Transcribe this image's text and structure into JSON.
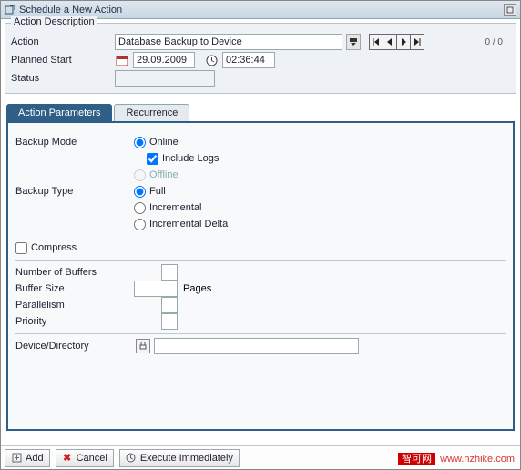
{
  "title": "Schedule a New Action",
  "desc": {
    "legend": "Action Description",
    "actionLabel": "Action",
    "actionValue": "Database Backup to Device",
    "plannedLabel": "Planned Start",
    "date": "29.09.2009",
    "time": "02:36:44",
    "statusLabel": "Status",
    "statusValue": "",
    "counter": "0  /  0"
  },
  "tabs": {
    "actionParams": "Action Parameters",
    "recurrence": "Recurrence"
  },
  "params": {
    "backupModeLabel": "Backup Mode",
    "online": "Online",
    "includeLogs": "Include Logs",
    "offline": "Offline",
    "backupTypeLabel": "Backup Type",
    "full": "Full",
    "incremental": "Incremental",
    "incrementalDelta": "Incremental Delta",
    "compress": "Compress",
    "numBuffersLabel": "Number of Buffers",
    "bufferSizeLabel": "Buffer Size",
    "pagesLabel": "Pages",
    "parallelismLabel": "Parallelism",
    "priorityLabel": "Priority",
    "deviceDirLabel": "Device/Directory"
  },
  "footer": {
    "add": "Add",
    "cancel": "Cancel",
    "execute": "Execute Immediately"
  },
  "watermark": {
    "red": "智可网",
    "url": "www.hzhike.com"
  }
}
